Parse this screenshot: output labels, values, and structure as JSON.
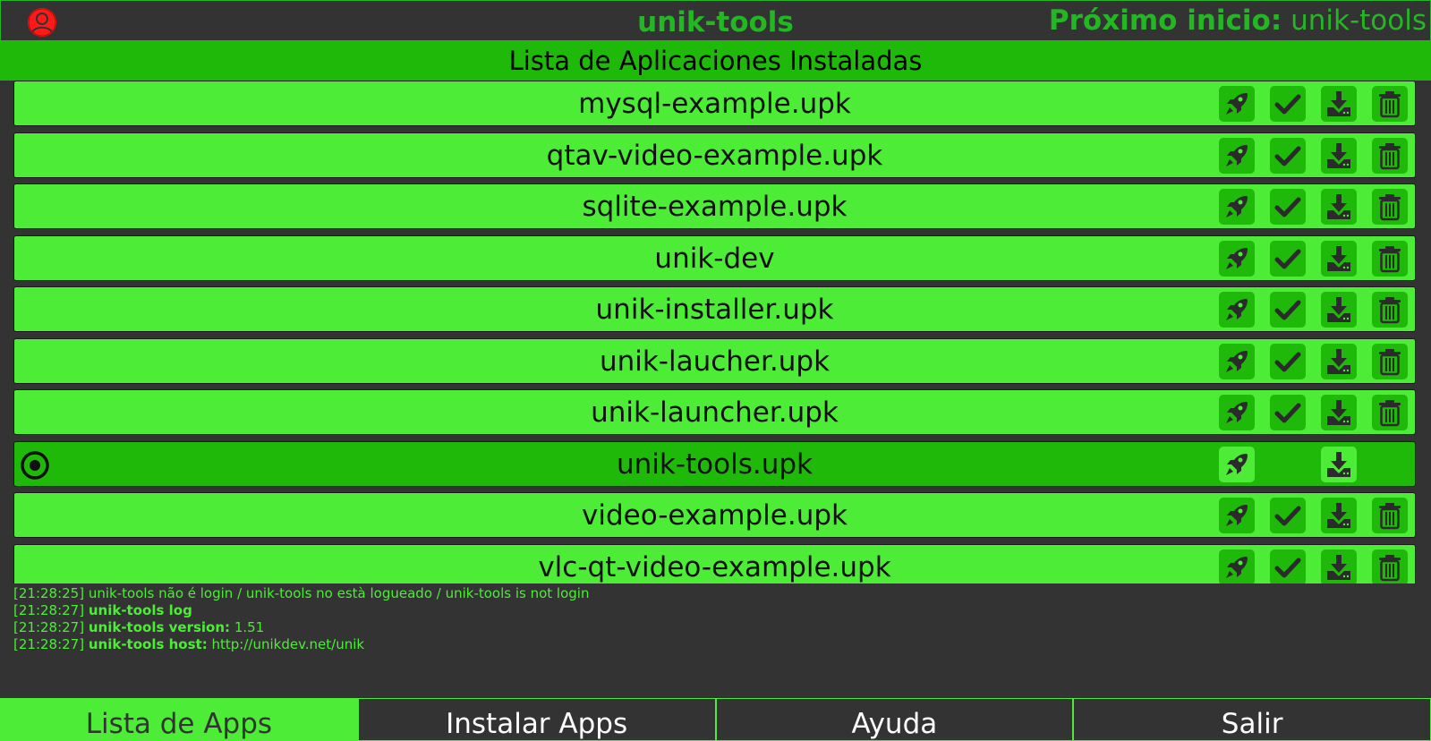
{
  "header": {
    "title": "unik-tools",
    "next_start_label": "Próximo inicio:",
    "next_start_value": " unik-tools"
  },
  "section_title": "Lista de Aplicaciones Instaladas",
  "apps": [
    {
      "name": "mysql-example.upk"
    },
    {
      "name": "qtav-video-example.upk"
    },
    {
      "name": "sqlite-example.upk"
    },
    {
      "name": "unik-dev"
    },
    {
      "name": "unik-installer.upk"
    },
    {
      "name": "unik-laucher.upk"
    },
    {
      "name": "unik-launcher.upk"
    },
    {
      "name": "unik-tools.upk"
    },
    {
      "name": "video-example.upk"
    },
    {
      "name": "vlc-qt-video-example.upk"
    }
  ],
  "log": [
    {
      "time": "[21:28:25]",
      "label": "",
      "text": "unik-tools não é login / unik-tools no està logueado / unik-tools is not login"
    },
    {
      "time": "[21:28:27]",
      "label": "unik-tools log",
      "text": ""
    },
    {
      "time": "[21:28:27]",
      "label": "unik-tools version:",
      "text": "1.51"
    },
    {
      "time": "[21:28:27]",
      "label": "unik-tools host:",
      "text": "http://unikdev.net/unik"
    }
  ],
  "nav": {
    "apps_list": "Lista de Apps",
    "install_apps": "Instalar Apps",
    "help": "Ayuda",
    "exit": "Salir"
  },
  "colors": {
    "accent": "#4dec37",
    "accent_dark": "#1fb90a",
    "title_green": "#23b823",
    "background": "#333333",
    "avatar_red": "#ff1a1a"
  },
  "icons": {
    "launch": "rocket-icon",
    "set_default": "check-icon",
    "download": "download-icon",
    "delete": "trash-icon",
    "current": "radio-selected-icon",
    "user": "user-avatar-icon"
  }
}
